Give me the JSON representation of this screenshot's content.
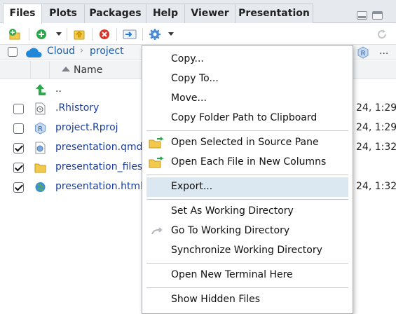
{
  "tabs": [
    {
      "label": "Files",
      "active": true
    },
    {
      "label": "Plots",
      "active": false
    },
    {
      "label": "Packages",
      "active": false
    },
    {
      "label": "Help",
      "active": false
    },
    {
      "label": "Viewer",
      "active": false
    },
    {
      "label": "Presentation",
      "active": false
    }
  ],
  "toolbar": {
    "icons": [
      "new-folder-icon",
      "new-file-icon",
      "upload-icon",
      "delete-icon",
      "rename-icon",
      "gear-icon",
      "refresh-icon"
    ]
  },
  "breadcrumb": {
    "root": "Cloud",
    "separator": "›",
    "current": "project",
    "overflow": "..."
  },
  "columns": {
    "name": "Name"
  },
  "files": [
    {
      "name": "..",
      "icon": "up-arrow-icon",
      "checked": null,
      "modified": ""
    },
    {
      "name": ".Rhistory",
      "icon": "history-file-icon",
      "checked": false,
      "modified": "24, 1:29"
    },
    {
      "name": "project.Rproj",
      "icon": "rproj-icon",
      "checked": false,
      "modified": "24, 1:29"
    },
    {
      "name": "presentation.qmd",
      "icon": "qmd-file-icon",
      "checked": true,
      "modified": "24, 1:32"
    },
    {
      "name": "presentation_files",
      "icon": "folder-icon",
      "checked": true,
      "modified": ""
    },
    {
      "name": "presentation.html",
      "icon": "html-file-icon",
      "checked": true,
      "modified": "24, 1:32"
    }
  ],
  "menu": {
    "items": [
      {
        "label": "Copy..."
      },
      {
        "label": "Copy To..."
      },
      {
        "label": "Move..."
      },
      {
        "label": "Copy Folder Path to Clipboard"
      },
      {
        "label": "Open Selected in Source Pane",
        "icon": "open-folder-icon"
      },
      {
        "label": "Open Each File in New Columns",
        "icon": "open-folder-icon"
      },
      {
        "label": "Export...",
        "highlighted": true
      },
      {
        "label": "Set As Working Directory"
      },
      {
        "label": "Go To Working Directory",
        "icon": "goto-arrow-icon"
      },
      {
        "label": "Synchronize Working Directory"
      },
      {
        "label": "Open New Terminal Here"
      },
      {
        "label": "Show Hidden Files"
      }
    ]
  },
  "colors": {
    "link": "#1a3d9c",
    "highlight": "#dbe7f1",
    "tabbar": "#e6e9ee"
  }
}
